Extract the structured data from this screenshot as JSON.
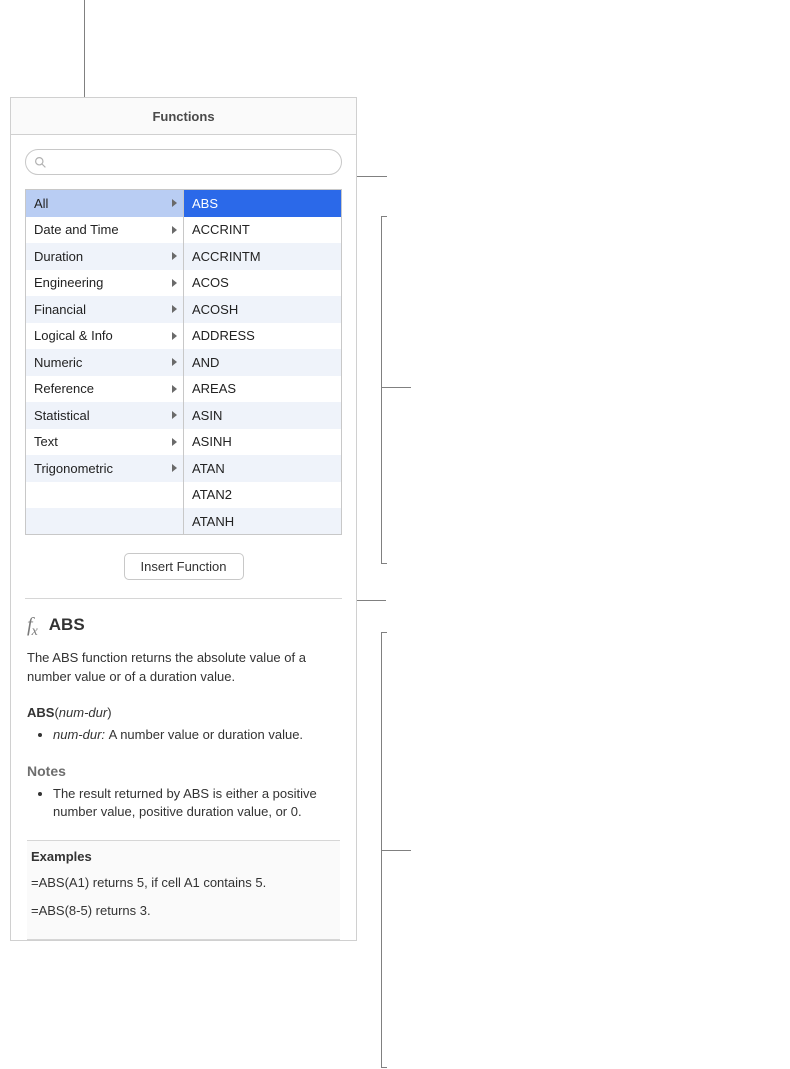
{
  "panel": {
    "title": "Functions",
    "search": {
      "placeholder": "",
      "value": ""
    },
    "categories": [
      {
        "label": "All",
        "selected": true
      },
      {
        "label": "Date and Time"
      },
      {
        "label": "Duration"
      },
      {
        "label": "Engineering"
      },
      {
        "label": "Financial"
      },
      {
        "label": "Logical & Info"
      },
      {
        "label": "Numeric"
      },
      {
        "label": "Reference"
      },
      {
        "label": "Statistical"
      },
      {
        "label": "Text"
      },
      {
        "label": "Trigonometric"
      }
    ],
    "functions": [
      {
        "label": "ABS",
        "selected": true
      },
      {
        "label": "ACCRINT"
      },
      {
        "label": "ACCRINTM"
      },
      {
        "label": "ACOS"
      },
      {
        "label": "ACOSH"
      },
      {
        "label": "ADDRESS"
      },
      {
        "label": "AND"
      },
      {
        "label": "AREAS"
      },
      {
        "label": "ASIN"
      },
      {
        "label": "ASINH"
      },
      {
        "label": "ATAN"
      },
      {
        "label": "ATAN2"
      },
      {
        "label": "ATANH"
      }
    ],
    "insert_label": "Insert Function"
  },
  "detail": {
    "title": "ABS",
    "description": "The ABS function returns the absolute value of a number value or of a duration value.",
    "syntax": {
      "fn": "ABS",
      "args_text": "num-dur"
    },
    "args": [
      {
        "name": "num-dur:",
        "desc": "A number value or duration value."
      }
    ],
    "notes_heading": "Notes",
    "notes": [
      "The result returned by ABS is either a positive number value, positive duration value, or 0."
    ],
    "examples_heading": "Examples",
    "examples": [
      "=ABS(A1) returns 5, if cell A1 contains 5.",
      "=ABS(8-5) returns 3."
    ]
  }
}
